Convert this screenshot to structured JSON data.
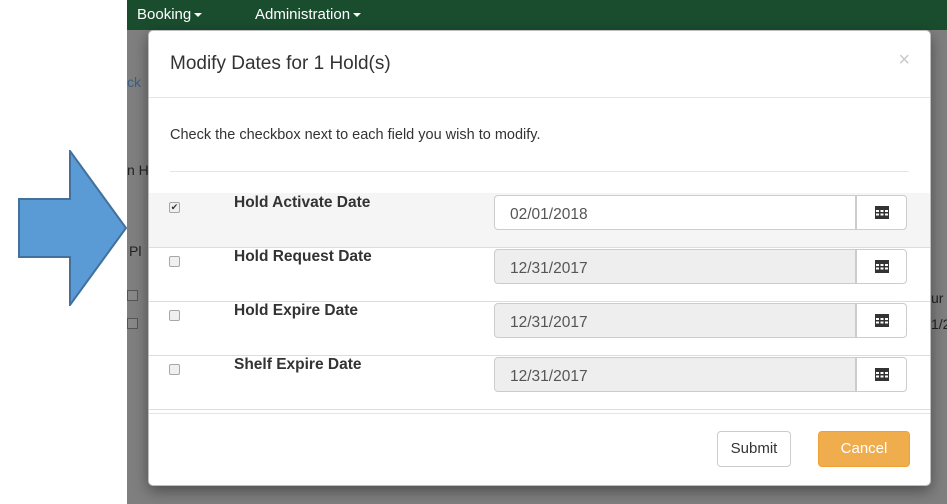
{
  "background": {
    "nav": [
      {
        "label": "Booking"
      },
      {
        "label": "Administration"
      }
    ],
    "fragments": [
      "ck",
      "n H",
      "Pl",
      "ur",
      "1/2"
    ]
  },
  "modal": {
    "title": "Modify Dates for 1 Hold(s)",
    "close_symbol": "×",
    "instructions": "Check the checkbox next to each field you wish to modify.",
    "fields": [
      {
        "label": "Hold Activate Date",
        "value": "02/01/2018",
        "checked": true,
        "check_mark": "✔"
      },
      {
        "label": "Hold Request Date",
        "value": "12/31/2017",
        "checked": false,
        "check_mark": ""
      },
      {
        "label": "Hold Expire Date",
        "value": "12/31/2017",
        "checked": false,
        "check_mark": ""
      },
      {
        "label": "Shelf Expire Date",
        "value": "12/31/2017",
        "checked": false,
        "check_mark": ""
      }
    ],
    "submit_label": "Submit",
    "cancel_label": "Cancel"
  },
  "colors": {
    "navbar": "#1a4d2e",
    "arrow_fill": "#5b9bd5",
    "arrow_stroke": "#41719c",
    "cancel_button": "#f0ad4e",
    "overlay": "#7f7f7f"
  }
}
